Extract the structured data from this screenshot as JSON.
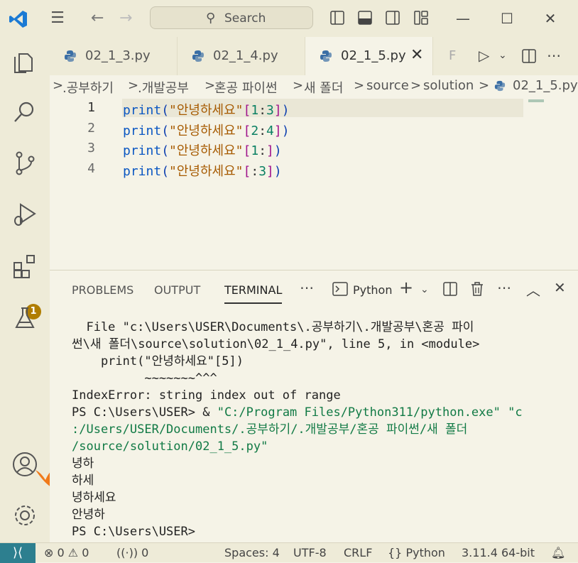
{
  "titlebar": {
    "search_placeholder": "Search",
    "back_icon": "arrow-left-icon",
    "forward_icon": "arrow-right-icon"
  },
  "activity_bar": {
    "items": [
      {
        "name": "explorer",
        "icon": "files-icon"
      },
      {
        "name": "search",
        "icon": "search-icon"
      },
      {
        "name": "source-control",
        "icon": "source-control-icon"
      },
      {
        "name": "run-and-debug",
        "icon": "debug-icon"
      },
      {
        "name": "extensions",
        "icon": "extensions-icon",
        "badge": "1"
      },
      {
        "name": "testing",
        "icon": "flask-icon"
      }
    ],
    "bottom": [
      {
        "name": "accounts",
        "icon": "account-icon"
      },
      {
        "name": "manage",
        "icon": "gear-icon"
      }
    ]
  },
  "tabs": [
    {
      "label": "02_1_3.py",
      "active": false
    },
    {
      "label": "02_1_4.py",
      "active": false
    },
    {
      "label": "02_1_5.py",
      "active": true
    },
    {
      "label": "F",
      "active": false
    }
  ],
  "breadcrumb": [
    ".공부하기",
    ".개발공부",
    "혼공 파이썬",
    "새 폴더",
    "source",
    "solution",
    "02_1_5.py"
  ],
  "editor": {
    "lines": [
      {
        "num": "1",
        "fn": "print",
        "str": "\"안녕하세요\"",
        "start": "1",
        "end": "3"
      },
      {
        "num": "2",
        "fn": "print",
        "str": "\"안녕하세요\"",
        "start": "2",
        "end": "4"
      },
      {
        "num": "3",
        "fn": "print",
        "str": "\"안녕하세요\"",
        "start": "1",
        "end": ""
      },
      {
        "num": "4",
        "fn": "print",
        "str": "\"안녕하세요\"",
        "start": "",
        "end": "3"
      }
    ]
  },
  "panel": {
    "tabs": [
      "PROBLEMS",
      "OUTPUT",
      "TERMINAL"
    ],
    "active_tab": "TERMINAL",
    "terminal_name": "Python",
    "terminal_lines": [
      {
        "text": "  File \"c:\\Users\\USER\\Documents\\.공부하기\\.개발공부\\혼공 파이",
        "color": "default"
      },
      {
        "text": "썬\\새 폴더\\source\\solution\\02_1_4.py\", line 5, in <module>",
        "color": "default"
      },
      {
        "text": "    print(\"안녕하세요\"[5])",
        "color": "default"
      },
      {
        "text": "          ~~~~~~~^^^",
        "color": "default"
      },
      {
        "text": "IndexError: string index out of range",
        "color": "default"
      },
      {
        "prompt": "PS C:\\Users\\USER> & ",
        "text": "\"C:/Program Files/Python311/python.exe\" \"c",
        "color": "green"
      },
      {
        "text": ":/Users/USER/Documents/.공부하기/.개발공부/혼공 파이썬/새 폴더",
        "color": "green"
      },
      {
        "text": "/source/solution/02_1_5.py\"",
        "color": "green"
      },
      {
        "text": "녕하",
        "color": "default"
      },
      {
        "text": "하세",
        "color": "default"
      },
      {
        "text": "녕하세요",
        "color": "default"
      },
      {
        "text": "안녕하",
        "color": "default"
      },
      {
        "text": "PS C:\\Users\\USER>",
        "color": "default"
      }
    ]
  },
  "statusbar": {
    "errors": "0",
    "warnings": "0",
    "ports": "0",
    "spaces": "Spaces: 4",
    "encoding": "UTF-8",
    "eol": "CRLF",
    "language": "Python",
    "interpreter": "3.11.4 64-bit"
  },
  "colors": {
    "accent": "#0b57c2",
    "remote": "#2d7f8f",
    "badge": "#b07d00",
    "terminal_green": "#117a45"
  }
}
